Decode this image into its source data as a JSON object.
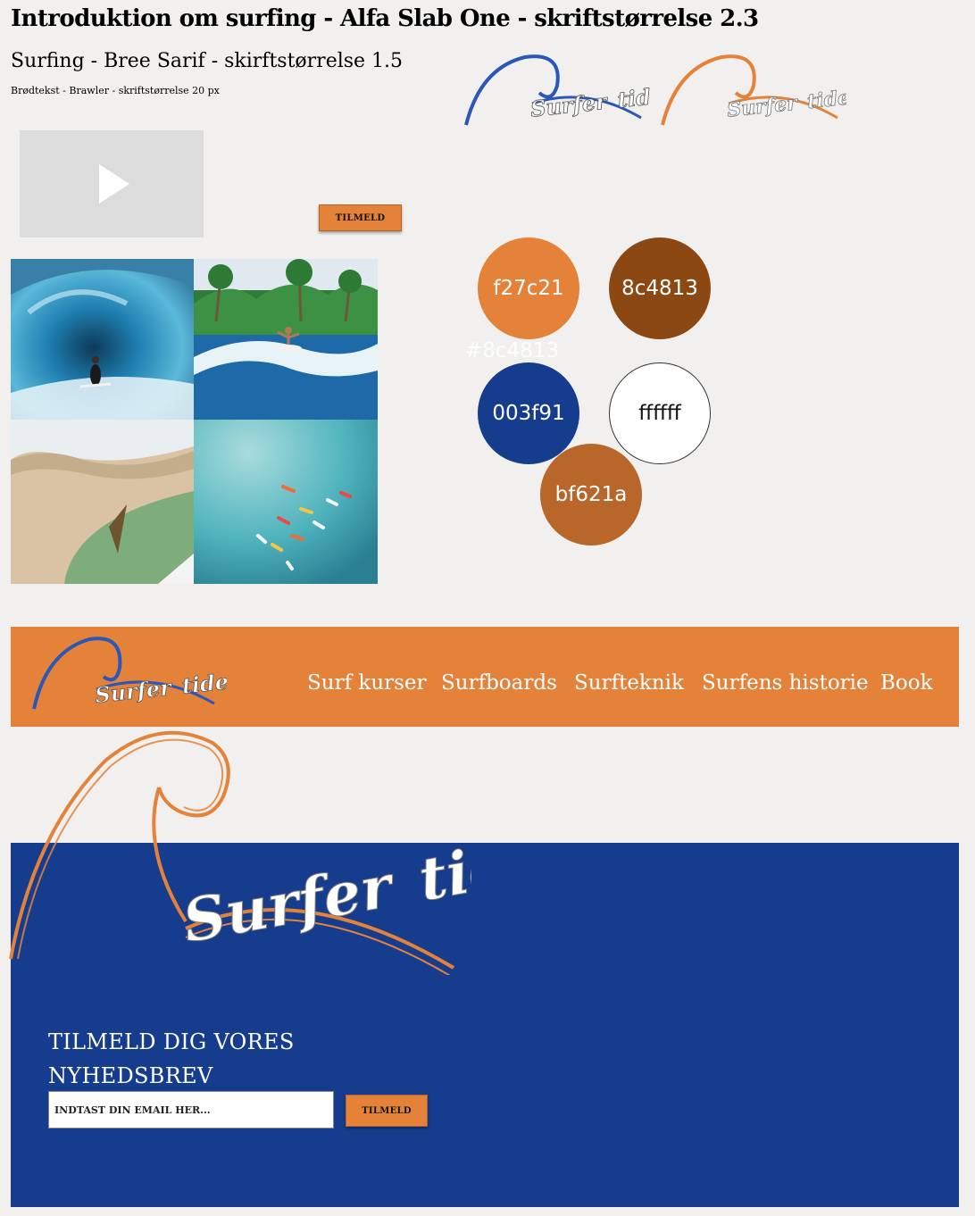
{
  "typography": {
    "heading": "Introduktion om surfing - Alfa Slab One - skriftstørrelse 2.3",
    "subheading": "Surfing - Bree Sarif - skirftstørrelse 1.5",
    "body": "Brødtekst - Brawler  - skriftstørrelse 20 px"
  },
  "cta": {
    "label": "TILMELD"
  },
  "logo": {
    "word1": "Surfer",
    "word2": "tide"
  },
  "palette": {
    "ghost_label": "#8c4813",
    "swatches": [
      {
        "label": "f27c21",
        "color": "#e58239"
      },
      {
        "label": "8c4813",
        "color": "#8c4813"
      },
      {
        "label": "003f91",
        "color": "#163c8e"
      },
      {
        "label": "ffffff",
        "color": "#ffffff"
      },
      {
        "label": "bf621a",
        "color": "#b8662a"
      }
    ]
  },
  "nav": {
    "items": [
      {
        "label": "Surf kurser"
      },
      {
        "label": "Surfboards"
      },
      {
        "label": "Surfteknik"
      },
      {
        "label": "Surfens historie"
      },
      {
        "label": "Book"
      }
    ]
  },
  "footer": {
    "title_line1": "TILMELD DIG VORES",
    "title_line2": "NYHEDSBREV",
    "email_placeholder": "INDTAST DIN EMAIL HER...",
    "submit_label": "TILMELD"
  }
}
